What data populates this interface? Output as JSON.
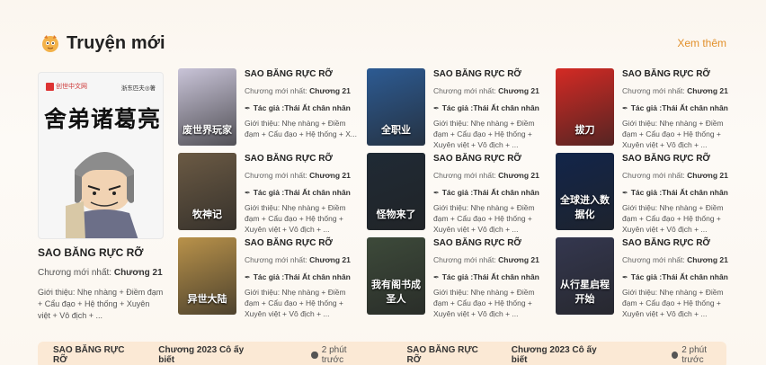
{
  "section": {
    "title": "Truyện mới",
    "see_more": "Xem thêm",
    "logo_icon": "dragon-mascot-icon"
  },
  "featured": {
    "title": "SAO BĂNG RỰC RỠ",
    "latest_label": "Chương mới nhất: ",
    "latest_chapter": "Chương 21",
    "description": "Giới thiệu: Nhẹ nhàng + Điềm đạm + Cẩu đạo + Hệ thống + Xuyên việt + Vô địch + ...",
    "cover": {
      "publisher": "创世中文网",
      "author_cn": "浙东匹夫◎著",
      "title_cn": "舍弟诸葛亮"
    }
  },
  "cards": [
    {
      "title": "SAO BĂNG RỰC RỠ",
      "latest_label": "Chương mới nhất: ",
      "latest_chapter": "Chương 21",
      "author_label": "Tác giả : ",
      "author": "Thái Ất chân nhân",
      "description": "Giới thiệu: Nhẹ nhàng + Điềm đạm + Cẩu đạo + Hệ thống + X...",
      "cover_text": "废世界玩家",
      "cover_color": "#c9c4d8"
    },
    {
      "title": "SAO BĂNG RỰC RỠ",
      "latest_label": "Chương mới nhất: ",
      "latest_chapter": "Chương 21",
      "author_label": "Tác giả : ",
      "author": "Thái Ất chân nhân",
      "description": "Giới thiệu: Nhẹ nhàng + Điềm đạm + Cẩu đạo + Hệ thống + Xuyên việt + Vô địch + ...",
      "cover_text": "牧神记",
      "cover_color": "#6b5a44"
    },
    {
      "title": "SAO BĂNG RỰC RỠ",
      "latest_label": "Chương mới nhất: ",
      "latest_chapter": "Chương 21",
      "author_label": "Tác giả : ",
      "author": "Thái Ất chân nhân",
      "description": "Giới thiệu: Nhẹ nhàng + Điềm đạm + Cẩu đạo + Hệ thống + Xuyên việt + Vô địch + ...",
      "cover_text": "异世大陆",
      "cover_color": "#b9924a"
    },
    {
      "title": "SAO BĂNG RỰC RỠ",
      "latest_label": "Chương mới nhất: ",
      "latest_chapter": "Chương 21",
      "author_label": "Tác giả : ",
      "author": "Thái Ất chân nhân",
      "description": "Giới thiệu: Nhẹ nhàng + Điềm đạm + Cẩu đạo + Hệ thống + Xuyên việt + Vô địch + ...",
      "cover_text": "全职业",
      "cover_color": "#2d5b93"
    },
    {
      "title": "SAO BĂNG RỰC RỠ",
      "latest_label": "Chương mới nhất: ",
      "latest_chapter": "Chương 21",
      "author_label": "Tác giả : ",
      "author": "Thái Ất chân nhân",
      "description": "Giới thiệu: Nhẹ nhàng + Điềm đạm + Cẩu đạo + Hệ thống + Xuyên việt + Vô địch + ...",
      "cover_text": "怪物来了",
      "cover_color": "#1f2a35"
    },
    {
      "title": "SAO BĂNG RỰC RỠ",
      "latest_label": "Chương mới nhất: ",
      "latest_chapter": "Chương 21",
      "author_label": "Tác giả : ",
      "author": "Thái Ất chân nhân",
      "description": "Giới thiệu: Nhẹ nhàng + Điềm đạm + Cẩu đạo + Hệ thống + Xuyên việt + Vô địch + ...",
      "cover_text": "我有阁书成圣人",
      "cover_color": "#3d4a3a"
    },
    {
      "title": "SAO BĂNG RỰC RỠ",
      "latest_label": "Chương mới nhất: ",
      "latest_chapter": "Chương 21",
      "author_label": "Tác giả : ",
      "author": "Thái Ất chân nhân",
      "description": "Giới thiệu: Nhẹ nhàng + Điềm đạm + Cẩu đạo + Hệ thống + Xuyên việt + Vô địch + ...",
      "cover_text": "拔刀",
      "cover_color": "#d42a24"
    },
    {
      "title": "SAO BĂNG RỰC RỠ",
      "latest_label": "Chương mới nhất: ",
      "latest_chapter": "Chương 21",
      "author_label": "Tác giả : ",
      "author": "Thái Ất chân nhân",
      "description": "Giới thiệu: Nhẹ nhàng + Điềm đạm + Cẩu đạo + Hệ thống + Xuyên việt + Vô địch + ...",
      "cover_text": "全球进入数据化",
      "cover_color": "#12254a"
    },
    {
      "title": "SAO BĂNG RỰC RỠ",
      "latest_label": "Chương mới nhất: ",
      "latest_chapter": "Chương 21",
      "author_label": "Tác giả : ",
      "author": "Thái Ất chân nhân",
      "description": "Giới thiệu: Nhẹ nhàng + Điềm đạm + Cẩu đạo + Hệ thống + Xuyên việt + Vô địch + ...",
      "cover_text": "从行星启程开始",
      "cover_color": "#34374f"
    }
  ],
  "bottom_rows": [
    {
      "title": "SAO BĂNG RỰC RỠ",
      "chapter": "Chương 2023 Cô ấy biết",
      "time": "2 phút trước"
    },
    {
      "title": "SAO BĂNG RỰC RỠ",
      "chapter": "Chương 2023 Cô ấy biết",
      "time": "2 phút trước"
    }
  ],
  "colors": {
    "accent": "#e2902b",
    "bar_bg": "#fbe9d5"
  }
}
